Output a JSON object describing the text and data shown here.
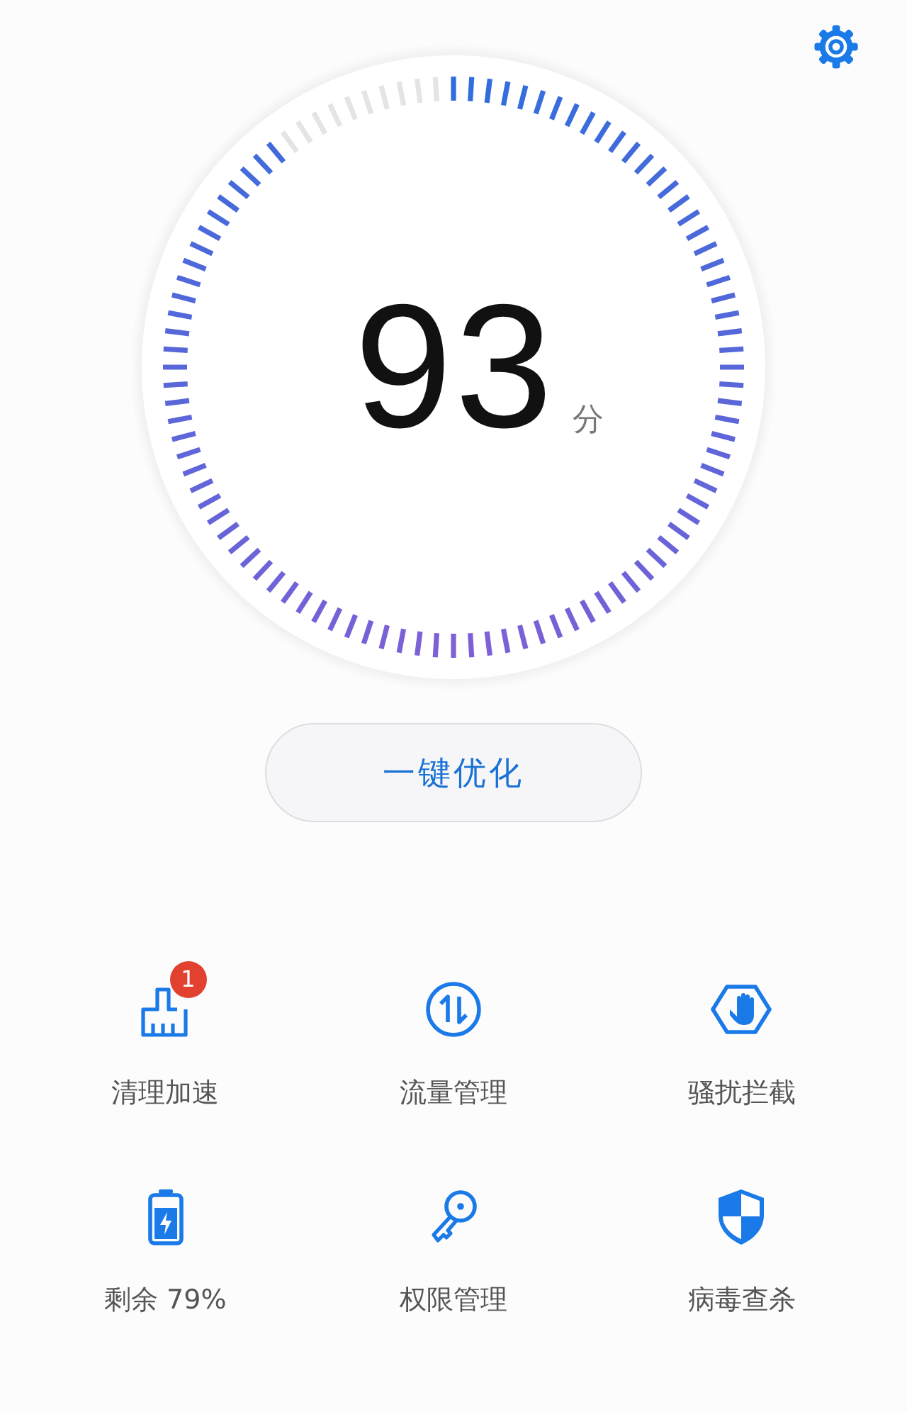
{
  "score": {
    "value": "93",
    "unit": "分"
  },
  "optimize_button": {
    "label": "一键优化"
  },
  "tools": [
    {
      "kind": "cleaner",
      "label": "清理加速",
      "badge": "1"
    },
    {
      "kind": "traffic",
      "label": "流量管理"
    },
    {
      "kind": "block",
      "label": "骚扰拦截"
    },
    {
      "kind": "battery",
      "label": "剩余 79%"
    },
    {
      "kind": "permission",
      "label": "权限管理"
    },
    {
      "kind": "virus",
      "label": "病毒查杀"
    }
  ]
}
